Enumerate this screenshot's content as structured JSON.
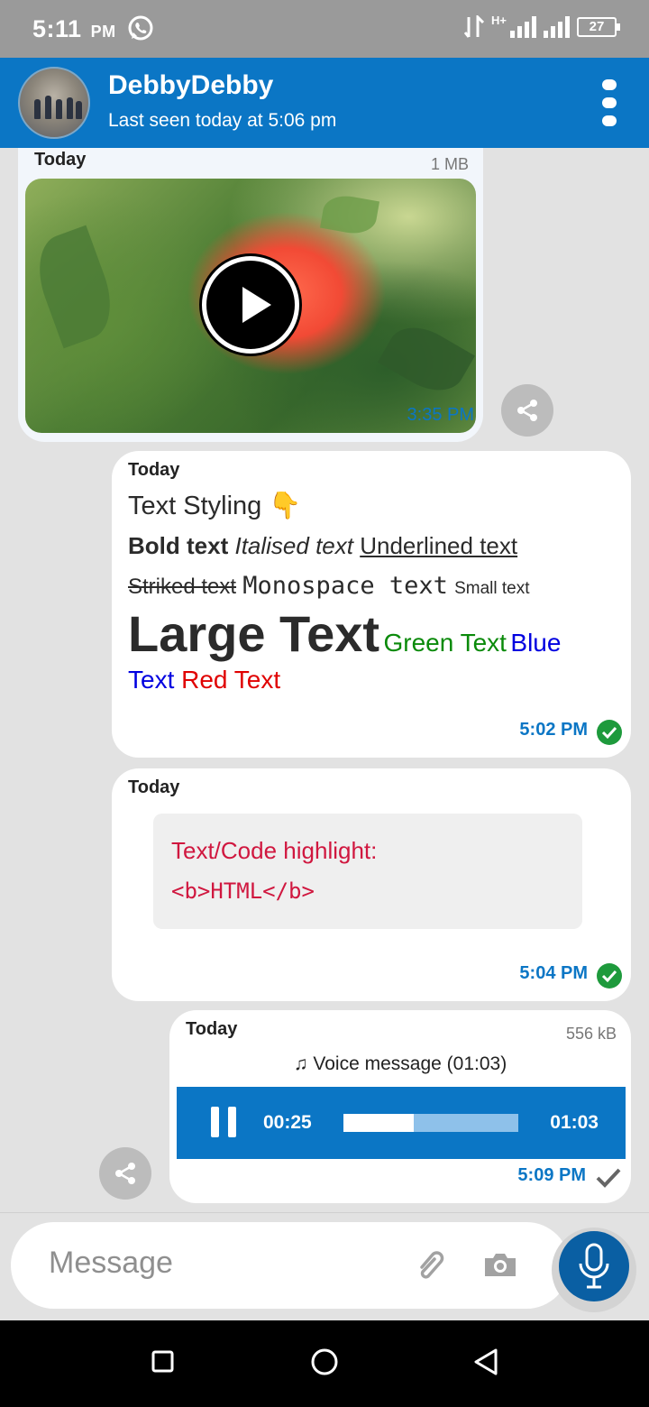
{
  "status_bar": {
    "time": "5:11",
    "ampm": "PM",
    "network": "H+",
    "battery": "27"
  },
  "header": {
    "contact_name": "DebbyDebby",
    "last_seen": "Last seen today at 5:06 pm"
  },
  "messages": [
    {
      "type": "video",
      "date": "Today",
      "size": "1 MB",
      "time": "3:35 PM"
    },
    {
      "type": "styled_text",
      "date": "Today",
      "title": "Text Styling 👇",
      "bold": "Bold text",
      "italic": "Italised text",
      "underline": "Underlined text",
      "strike": "Striked text",
      "mono": "Monospace text",
      "small": "Small text",
      "large": "Large Text",
      "green": "Green Text",
      "blue_a": "Blue",
      "blue_b": "Text",
      "red": "Red Text",
      "time": "5:02 PM",
      "status": "delivered"
    },
    {
      "type": "code",
      "date": "Today",
      "code_title": "Text/Code highlight:",
      "code_html": "<b>HTML</b>",
      "time": "5:04 PM",
      "status": "delivered"
    },
    {
      "type": "voice",
      "date": "Today",
      "size": "556 kB",
      "title": "♫ Voice message (01:03)",
      "current_time": "00:25",
      "total_time": "01:03",
      "progress": 0.4,
      "time": "5:09 PM",
      "status": "sent"
    }
  ],
  "input": {
    "placeholder": "Message"
  },
  "colors": {
    "header": "#0b76c5",
    "time_text": "#0b76c5",
    "delivered_check": "#1e9a3c",
    "code_text": "#d0173f"
  }
}
